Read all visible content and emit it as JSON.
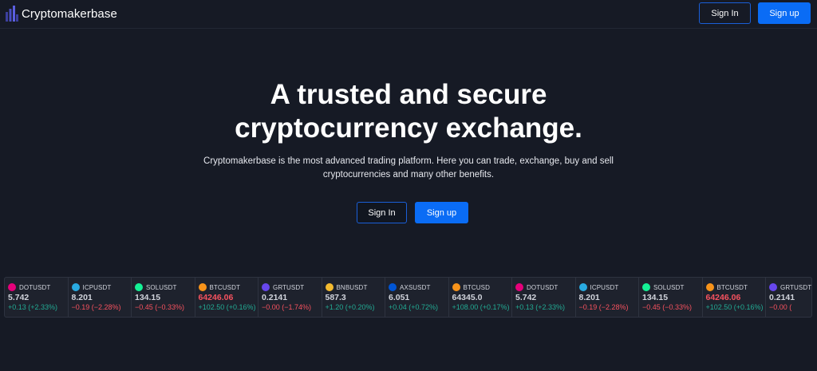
{
  "header": {
    "brand": "Cryptomakerbase",
    "sign_in": "Sign In",
    "sign_up": "Sign up"
  },
  "hero": {
    "title_line1": "A trusted and secure",
    "title_line2": "cryptocurrency exchange.",
    "subtitle_line1": "Cryptomakerbase is the most advanced trading platform. Here you can trade, exchange, buy and sell",
    "subtitle_line2": "cryptocurrencies and many other benefits.",
    "sign_in": "Sign In",
    "sign_up": "Sign up"
  },
  "colors": {
    "background": "#161a25",
    "accent": "#0a6cf5",
    "up": "#22ab94",
    "down": "#f7525f"
  },
  "ticker": [
    {
      "symbol": "DOTUSDT",
      "price": "5.742",
      "change": "+0.13 (+2.33%)",
      "dir": "up",
      "icon": "polkadot-icon",
      "color": "#e6007a"
    },
    {
      "symbol": "ICPUSDT",
      "price": "8.201",
      "change": "−0.19 (−2.28%)",
      "dir": "down",
      "icon": "icp-icon",
      "color": "#29abe2"
    },
    {
      "symbol": "SOLUSDT",
      "price": "134.15",
      "change": "−0.45 (−0.33%)",
      "dir": "down",
      "icon": "solana-icon",
      "color": "#14f195"
    },
    {
      "symbol": "BTCUSDT",
      "price": "64246.06",
      "change": "+102.50 (+0.16%)",
      "dir": "up",
      "price_dir": "down",
      "icon": "bitcoin-icon",
      "color": "#f7931a"
    },
    {
      "symbol": "GRTUSDT",
      "price": "0.2141",
      "change": "−0.00 (−1.74%)",
      "dir": "down",
      "icon": "graph-icon",
      "color": "#6747ed"
    },
    {
      "symbol": "BNBUSDT",
      "price": "587.3",
      "change": "+1.20 (+0.20%)",
      "dir": "up",
      "icon": "bnb-icon",
      "color": "#f3ba2f"
    },
    {
      "symbol": "AXSUSDT",
      "price": "6.051",
      "change": "+0.04 (+0.72%)",
      "dir": "up",
      "icon": "axie-icon",
      "color": "#0055d5"
    },
    {
      "symbol": "BTCUSD",
      "price": "64345.0",
      "change": "+108.00 (+0.17%)",
      "dir": "up",
      "icon": "bitcoin-icon",
      "color": "#f7931a"
    },
    {
      "symbol": "DOTUSDT",
      "price": "5.742",
      "change": "+0.13 (+2.33%)",
      "dir": "up",
      "icon": "polkadot-icon",
      "color": "#e6007a"
    },
    {
      "symbol": "ICPUSDT",
      "price": "8.201",
      "change": "−0.19 (−2.28%)",
      "dir": "down",
      "icon": "icp-icon",
      "color": "#29abe2"
    },
    {
      "symbol": "SOLUSDT",
      "price": "134.15",
      "change": "−0.45 (−0.33%)",
      "dir": "down",
      "icon": "solana-icon",
      "color": "#14f195"
    },
    {
      "symbol": "BTCUSDT",
      "price": "64246.06",
      "change": "+102.50 (+0.16%)",
      "dir": "up",
      "price_dir": "down",
      "icon": "bitcoin-icon",
      "color": "#f7931a"
    },
    {
      "symbol": "GRTUSDT",
      "price": "0.2141",
      "change": "−0.00 (",
      "dir": "down",
      "icon": "graph-icon",
      "color": "#6747ed"
    }
  ]
}
